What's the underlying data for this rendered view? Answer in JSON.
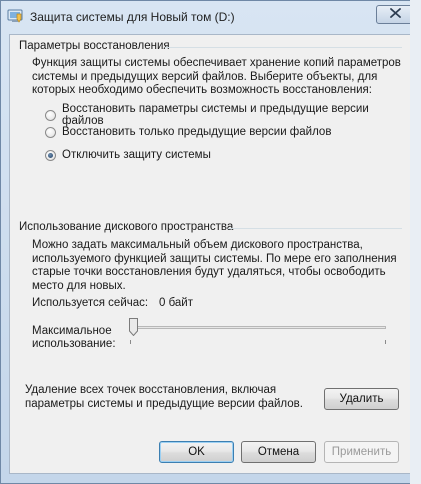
{
  "window": {
    "title": "Защита системы для Новый том (D:)"
  },
  "restore": {
    "group_title": "Параметры восстановления",
    "description": [
      "Функция защиты системы обеспечивает хранение копий параметров",
      "системы и предыдущих версий файлов. Выберите объекты, для",
      "которых необходимо обеспечить возможность восстановления:"
    ],
    "options": [
      {
        "label": "Восстановить параметры системы и предыдущие версии файлов",
        "checked": false
      },
      {
        "label": "Восстановить только предыдущие версии файлов",
        "checked": false
      },
      {
        "label": "Отключить защиту системы",
        "checked": true
      }
    ]
  },
  "disk": {
    "group_title": "Использование дискового пространства",
    "description": [
      "Можно задать максимальный объем дискового пространства,",
      "используемого функцией защиты системы. По мере его заполнения",
      "старые точки восстановления будут удаляться, чтобы освободить",
      "место для новых."
    ],
    "used_label": "Используется сейчас:",
    "used_value": "0 байт",
    "max_label": [
      "Максимальное",
      "использование:"
    ],
    "max_usage_level": 0
  },
  "delete_section": {
    "text": [
      "Удаление всех точек восстановления, включая",
      "параметры системы и предыдущие версии файлов."
    ],
    "button": "Удалить"
  },
  "footer": {
    "ok": "OK",
    "cancel": "Отмена",
    "apply": "Применить"
  },
  "colors": {
    "window_frame": "#c4d6ea",
    "client_bg": "#f0f0f0",
    "default_button_border": "#3c7fb1"
  },
  "icons": {
    "title": "system-protection-icon",
    "close": "close-icon"
  }
}
